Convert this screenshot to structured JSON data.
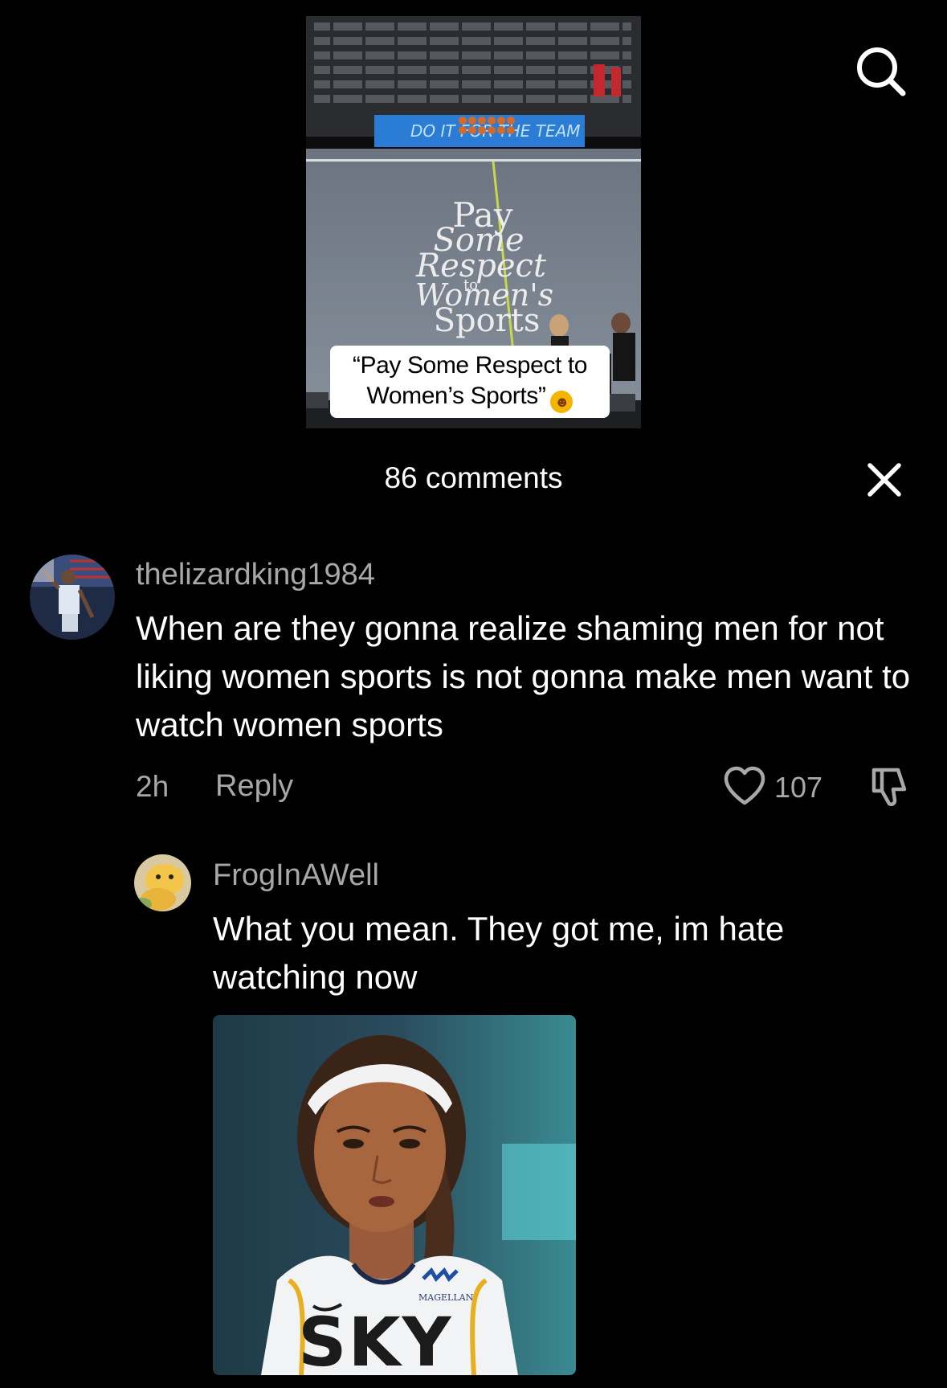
{
  "video": {
    "caption": "“Pay Some Respect to Women’s Sports”",
    "caption_emoji": "face-with-steam-emoji",
    "court_text": [
      "Pay",
      "Some",
      "Respect",
      "to",
      "Women's",
      "Sports"
    ],
    "banner_text": "DO IT FOR THE TEAM"
  },
  "icons": {
    "search": "search-icon",
    "close": "close-icon",
    "like": "heart-outline-icon",
    "dislike": "thumbs-down-icon"
  },
  "comments_header": {
    "count_label": "86 comments"
  },
  "comments": [
    {
      "username": "thelizardking1984",
      "text": "When are they gonna realize shaming men for not liking women sports is not gonna make men want to watch women sports",
      "time": "2h",
      "reply_label": "Reply",
      "likes": "107"
    },
    {
      "username": "FrogInAWell",
      "text": "What you mean. They got me, im hate watching now",
      "image_jersey_text": "SKY",
      "image_sponsor_text": "MAGELLAN"
    }
  ],
  "colors": {
    "background": "#000000",
    "text_primary": "#ffffff",
    "text_secondary": "#a8a8a8"
  }
}
